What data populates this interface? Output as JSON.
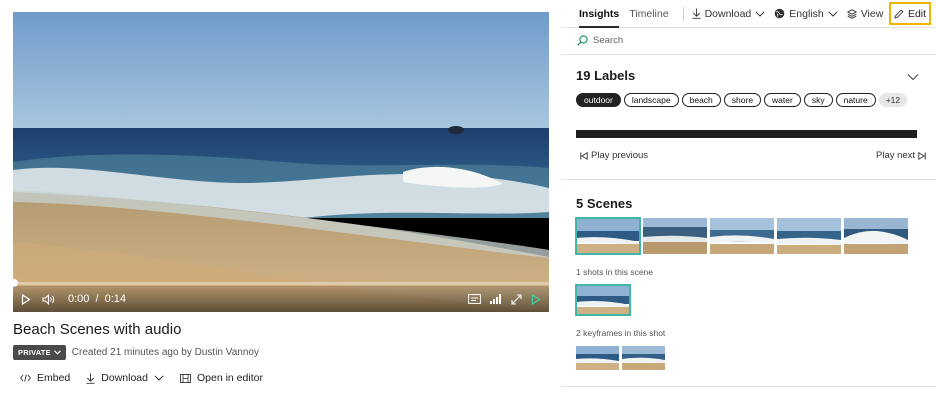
{
  "player": {
    "time_current": "0:00",
    "time_separator": "/",
    "time_total": "0:14",
    "progress": 0.0
  },
  "video": {
    "title": "Beach Scenes with audio",
    "privacy": "PRIVATE",
    "created": "Created 21 minutes ago by Dustin Vannoy"
  },
  "actions": {
    "embed": "Embed",
    "download": "Download",
    "open_editor": "Open in editor"
  },
  "topbar": {
    "tab_insights": "Insights",
    "tab_timeline": "Timeline",
    "download": "Download",
    "language": "English",
    "view": "View",
    "edit": "Edit"
  },
  "search": {
    "placeholder": "Search"
  },
  "labels": {
    "title": "19 Labels",
    "chips": [
      "outdoor",
      "landscape",
      "beach",
      "shore",
      "water",
      "sky",
      "nature"
    ],
    "more": "+12",
    "play_previous": "Play previous",
    "play_next": "Play next"
  },
  "scenes": {
    "title": "5 Scenes",
    "shots_label": "1 shots in this scene",
    "keyframes_label": "2 keyframes in this shot"
  },
  "colors": {
    "edit_highlight": "#f1b500",
    "selection_accent": "#3fb8a8",
    "play_accent": "#3fcf9c"
  }
}
